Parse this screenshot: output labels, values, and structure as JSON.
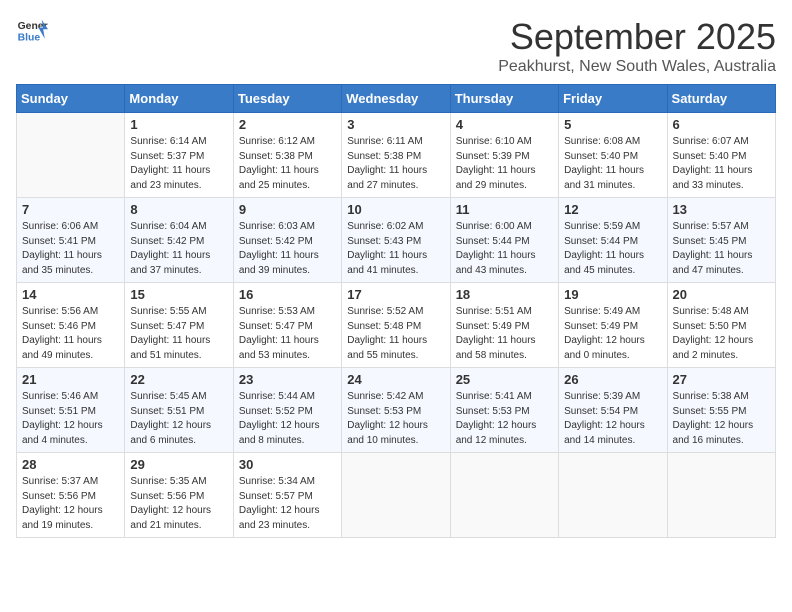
{
  "logo": {
    "line1": "General",
    "line2": "Blue"
  },
  "title": "September 2025",
  "subtitle": "Peakhurst, New South Wales, Australia",
  "days_of_week": [
    "Sunday",
    "Monday",
    "Tuesday",
    "Wednesday",
    "Thursday",
    "Friday",
    "Saturday"
  ],
  "weeks": [
    [
      {
        "day": "",
        "sunrise": "",
        "sunset": "",
        "daylight": ""
      },
      {
        "day": "1",
        "sunrise": "Sunrise: 6:14 AM",
        "sunset": "Sunset: 5:37 PM",
        "daylight": "Daylight: 11 hours and 23 minutes."
      },
      {
        "day": "2",
        "sunrise": "Sunrise: 6:12 AM",
        "sunset": "Sunset: 5:38 PM",
        "daylight": "Daylight: 11 hours and 25 minutes."
      },
      {
        "day": "3",
        "sunrise": "Sunrise: 6:11 AM",
        "sunset": "Sunset: 5:38 PM",
        "daylight": "Daylight: 11 hours and 27 minutes."
      },
      {
        "day": "4",
        "sunrise": "Sunrise: 6:10 AM",
        "sunset": "Sunset: 5:39 PM",
        "daylight": "Daylight: 11 hours and 29 minutes."
      },
      {
        "day": "5",
        "sunrise": "Sunrise: 6:08 AM",
        "sunset": "Sunset: 5:40 PM",
        "daylight": "Daylight: 11 hours and 31 minutes."
      },
      {
        "day": "6",
        "sunrise": "Sunrise: 6:07 AM",
        "sunset": "Sunset: 5:40 PM",
        "daylight": "Daylight: 11 hours and 33 minutes."
      }
    ],
    [
      {
        "day": "7",
        "sunrise": "Sunrise: 6:06 AM",
        "sunset": "Sunset: 5:41 PM",
        "daylight": "Daylight: 11 hours and 35 minutes."
      },
      {
        "day": "8",
        "sunrise": "Sunrise: 6:04 AM",
        "sunset": "Sunset: 5:42 PM",
        "daylight": "Daylight: 11 hours and 37 minutes."
      },
      {
        "day": "9",
        "sunrise": "Sunrise: 6:03 AM",
        "sunset": "Sunset: 5:42 PM",
        "daylight": "Daylight: 11 hours and 39 minutes."
      },
      {
        "day": "10",
        "sunrise": "Sunrise: 6:02 AM",
        "sunset": "Sunset: 5:43 PM",
        "daylight": "Daylight: 11 hours and 41 minutes."
      },
      {
        "day": "11",
        "sunrise": "Sunrise: 6:00 AM",
        "sunset": "Sunset: 5:44 PM",
        "daylight": "Daylight: 11 hours and 43 minutes."
      },
      {
        "day": "12",
        "sunrise": "Sunrise: 5:59 AM",
        "sunset": "Sunset: 5:44 PM",
        "daylight": "Daylight: 11 hours and 45 minutes."
      },
      {
        "day": "13",
        "sunrise": "Sunrise: 5:57 AM",
        "sunset": "Sunset: 5:45 PM",
        "daylight": "Daylight: 11 hours and 47 minutes."
      }
    ],
    [
      {
        "day": "14",
        "sunrise": "Sunrise: 5:56 AM",
        "sunset": "Sunset: 5:46 PM",
        "daylight": "Daylight: 11 hours and 49 minutes."
      },
      {
        "day": "15",
        "sunrise": "Sunrise: 5:55 AM",
        "sunset": "Sunset: 5:47 PM",
        "daylight": "Daylight: 11 hours and 51 minutes."
      },
      {
        "day": "16",
        "sunrise": "Sunrise: 5:53 AM",
        "sunset": "Sunset: 5:47 PM",
        "daylight": "Daylight: 11 hours and 53 minutes."
      },
      {
        "day": "17",
        "sunrise": "Sunrise: 5:52 AM",
        "sunset": "Sunset: 5:48 PM",
        "daylight": "Daylight: 11 hours and 55 minutes."
      },
      {
        "day": "18",
        "sunrise": "Sunrise: 5:51 AM",
        "sunset": "Sunset: 5:49 PM",
        "daylight": "Daylight: 11 hours and 58 minutes."
      },
      {
        "day": "19",
        "sunrise": "Sunrise: 5:49 AM",
        "sunset": "Sunset: 5:49 PM",
        "daylight": "Daylight: 12 hours and 0 minutes."
      },
      {
        "day": "20",
        "sunrise": "Sunrise: 5:48 AM",
        "sunset": "Sunset: 5:50 PM",
        "daylight": "Daylight: 12 hours and 2 minutes."
      }
    ],
    [
      {
        "day": "21",
        "sunrise": "Sunrise: 5:46 AM",
        "sunset": "Sunset: 5:51 PM",
        "daylight": "Daylight: 12 hours and 4 minutes."
      },
      {
        "day": "22",
        "sunrise": "Sunrise: 5:45 AM",
        "sunset": "Sunset: 5:51 PM",
        "daylight": "Daylight: 12 hours and 6 minutes."
      },
      {
        "day": "23",
        "sunrise": "Sunrise: 5:44 AM",
        "sunset": "Sunset: 5:52 PM",
        "daylight": "Daylight: 12 hours and 8 minutes."
      },
      {
        "day": "24",
        "sunrise": "Sunrise: 5:42 AM",
        "sunset": "Sunset: 5:53 PM",
        "daylight": "Daylight: 12 hours and 10 minutes."
      },
      {
        "day": "25",
        "sunrise": "Sunrise: 5:41 AM",
        "sunset": "Sunset: 5:53 PM",
        "daylight": "Daylight: 12 hours and 12 minutes."
      },
      {
        "day": "26",
        "sunrise": "Sunrise: 5:39 AM",
        "sunset": "Sunset: 5:54 PM",
        "daylight": "Daylight: 12 hours and 14 minutes."
      },
      {
        "day": "27",
        "sunrise": "Sunrise: 5:38 AM",
        "sunset": "Sunset: 5:55 PM",
        "daylight": "Daylight: 12 hours and 16 minutes."
      }
    ],
    [
      {
        "day": "28",
        "sunrise": "Sunrise: 5:37 AM",
        "sunset": "Sunset: 5:56 PM",
        "daylight": "Daylight: 12 hours and 19 minutes."
      },
      {
        "day": "29",
        "sunrise": "Sunrise: 5:35 AM",
        "sunset": "Sunset: 5:56 PM",
        "daylight": "Daylight: 12 hours and 21 minutes."
      },
      {
        "day": "30",
        "sunrise": "Sunrise: 5:34 AM",
        "sunset": "Sunset: 5:57 PM",
        "daylight": "Daylight: 12 hours and 23 minutes."
      },
      {
        "day": "",
        "sunrise": "",
        "sunset": "",
        "daylight": ""
      },
      {
        "day": "",
        "sunrise": "",
        "sunset": "",
        "daylight": ""
      },
      {
        "day": "",
        "sunrise": "",
        "sunset": "",
        "daylight": ""
      },
      {
        "day": "",
        "sunrise": "",
        "sunset": "",
        "daylight": ""
      }
    ]
  ]
}
